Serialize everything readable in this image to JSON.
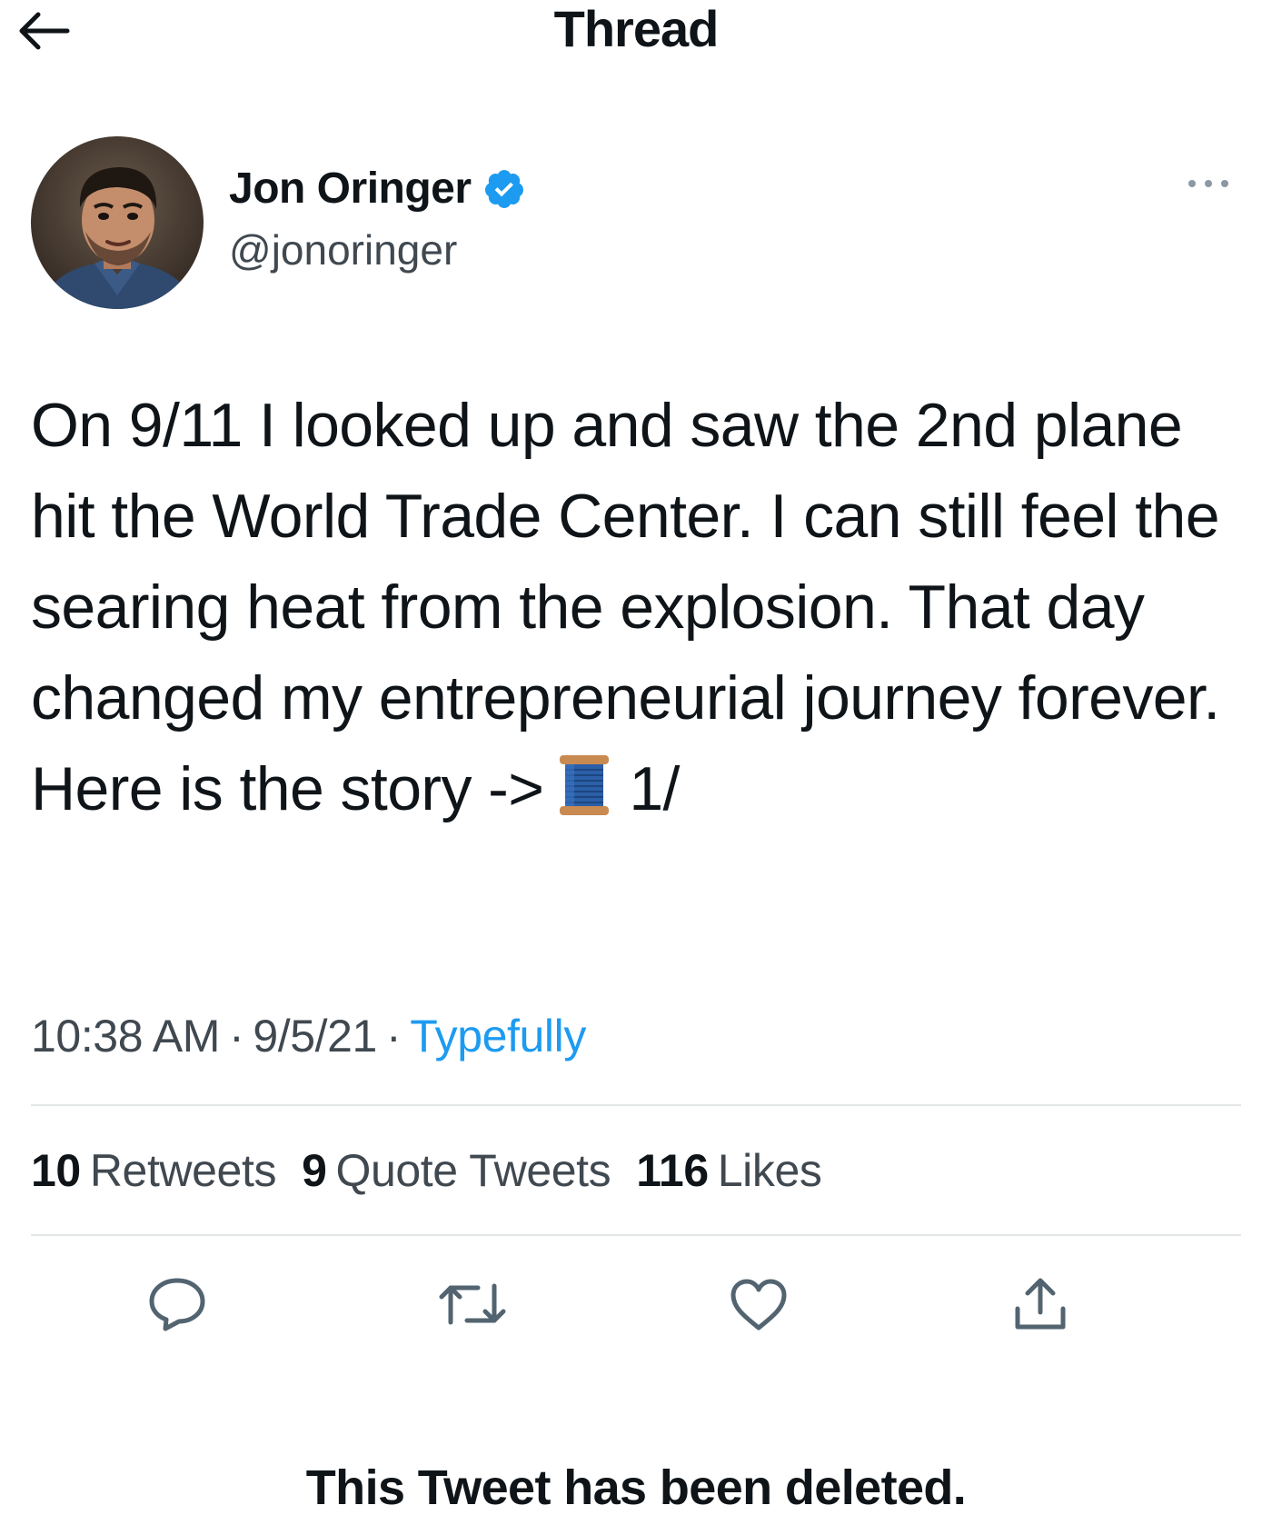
{
  "header": {
    "title": "Thread",
    "back_icon": "arrow-left-icon"
  },
  "author": {
    "display_name": "Jon Oringer",
    "handle": "@jonoringer",
    "verified": true,
    "verified_color": "#1d9bf0",
    "more_icon": "more-dots-icon"
  },
  "tweet": {
    "text_before_emoji": "On 9/11 I looked up and saw the 2nd plane hit the World Trade Center. I can still feel the searing heat from the explosion. That day changed my entrepreneurial journey forever. Here is the story ->",
    "emoji": "spool-of-thread-icon",
    "text_after_emoji": "1/"
  },
  "meta": {
    "time": "10:38 AM",
    "separator": "·",
    "date": "9/5/21",
    "source": "Typefully",
    "source_color": "#1d9bf0"
  },
  "stats": {
    "retweets_count": "10",
    "retweets_label": "Retweets",
    "quotes_count": "9",
    "quotes_label": "Quote Tweets",
    "likes_count": "116",
    "likes_label": "Likes"
  },
  "actions": [
    "reply-icon",
    "retweet-icon",
    "like-icon",
    "share-icon"
  ],
  "footer": {
    "deleted_notice": "This Tweet has been deleted."
  }
}
